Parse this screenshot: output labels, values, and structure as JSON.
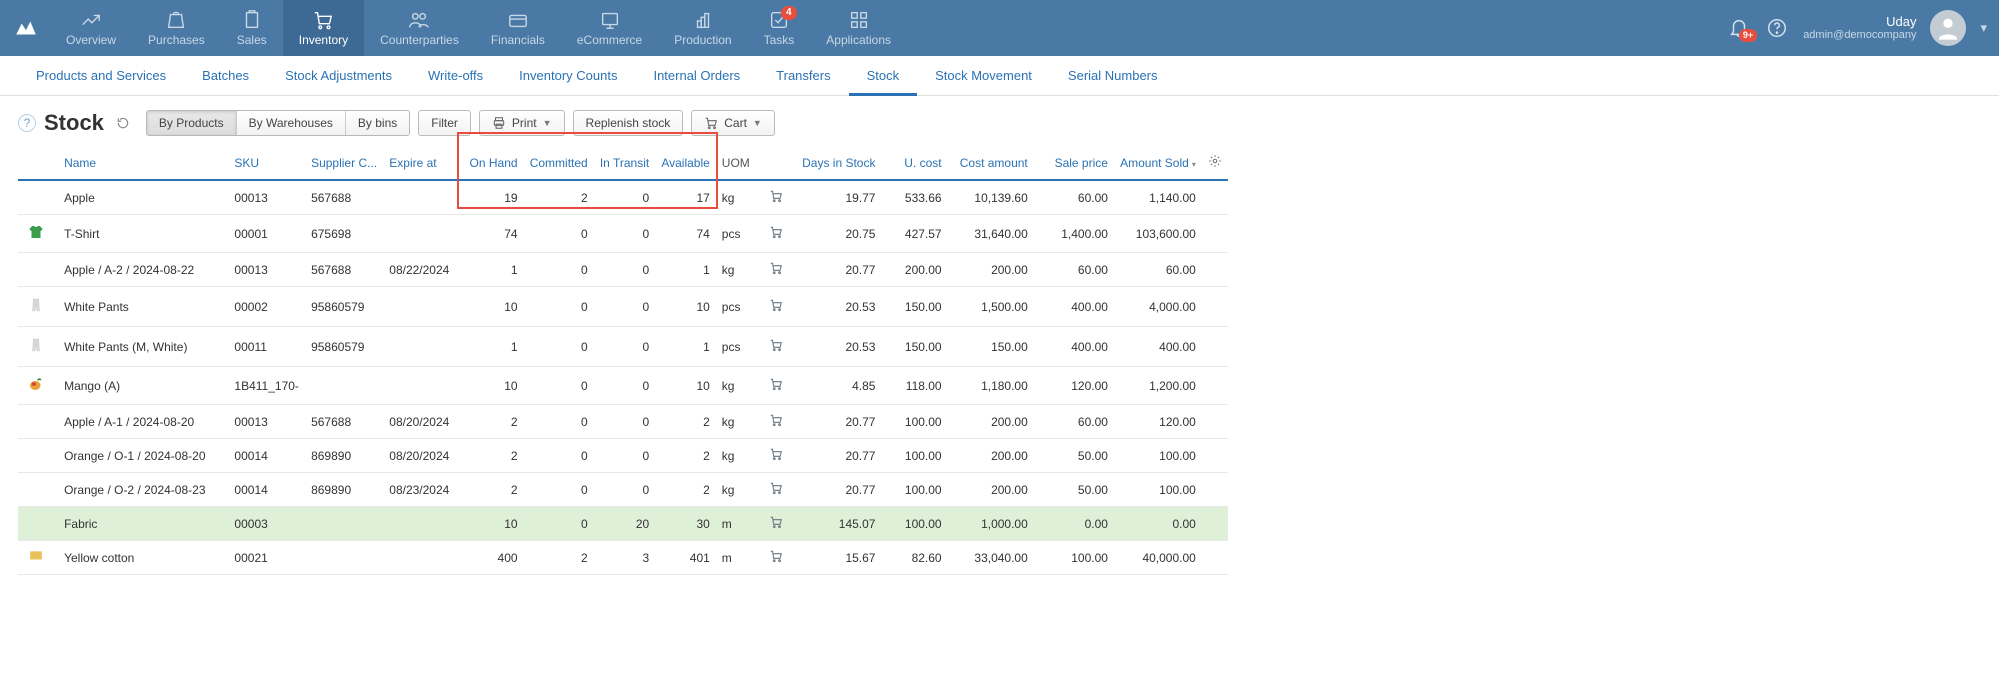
{
  "topnav": {
    "items": [
      {
        "label": "Overview"
      },
      {
        "label": "Purchases"
      },
      {
        "label": "Sales"
      },
      {
        "label": "Inventory"
      },
      {
        "label": "Counterparties"
      },
      {
        "label": "Financials"
      },
      {
        "label": "eCommerce"
      },
      {
        "label": "Production"
      },
      {
        "label": "Tasks"
      },
      {
        "label": "Applications"
      }
    ],
    "tasks_badge": "4",
    "bell_badge": "9+",
    "user": {
      "name": "Uday",
      "email": "admin@democompany"
    }
  },
  "subnav": {
    "tabs": [
      {
        "label": "Products and Services"
      },
      {
        "label": "Batches"
      },
      {
        "label": "Stock Adjustments"
      },
      {
        "label": "Write-offs"
      },
      {
        "label": "Inventory Counts"
      },
      {
        "label": "Internal Orders"
      },
      {
        "label": "Transfers"
      },
      {
        "label": "Stock"
      },
      {
        "label": "Stock Movement"
      },
      {
        "label": "Serial Numbers"
      }
    ],
    "active_index": 7
  },
  "toolbar": {
    "title": "Stock",
    "segments": [
      {
        "label": "By Products"
      },
      {
        "label": "By Warehouses"
      },
      {
        "label": "By bins"
      }
    ],
    "segment_active": 0,
    "filter": "Filter",
    "print": "Print",
    "replenish": "Replenish stock",
    "cart": "Cart"
  },
  "table": {
    "columns": {
      "name": "Name",
      "sku": "SKU",
      "supplier_code": "Supplier C...",
      "expire": "Expire at",
      "on_hand": "On Hand",
      "committed": "Committed",
      "in_transit": "In Transit",
      "available": "Available",
      "uom": "UOM",
      "days_in_stock": "Days in Stock",
      "u_cost": "U. cost",
      "cost_amount": "Cost amount",
      "sale_price": "Sale price",
      "amount_sold": "Amount Sold"
    },
    "rows": [
      {
        "icon": "",
        "name": "Apple",
        "sku": "00013",
        "supplier_code": "567688",
        "expire": "",
        "on_hand": "19",
        "committed": "2",
        "in_transit": "0",
        "available": "17",
        "uom": "kg",
        "days": "19.77",
        "u_cost": "533.66",
        "cost_amount": "10,139.60",
        "sale_price": "60.00",
        "amount_sold": "1,140.00"
      },
      {
        "icon": "tshirt",
        "name": "T-Shirt",
        "sku": "00001",
        "supplier_code": "675698",
        "expire": "",
        "on_hand": "74",
        "committed": "0",
        "in_transit": "0",
        "available": "74",
        "uom": "pcs",
        "days": "20.75",
        "u_cost": "427.57",
        "cost_amount": "31,640.00",
        "sale_price": "1,400.00",
        "amount_sold": "103,600.00"
      },
      {
        "icon": "",
        "name": "Apple / A-2 / 2024-08-22",
        "sku": "00013",
        "supplier_code": "567688",
        "expire": "08/22/2024",
        "on_hand": "1",
        "committed": "0",
        "in_transit": "0",
        "available": "1",
        "uom": "kg",
        "days": "20.77",
        "u_cost": "200.00",
        "cost_amount": "200.00",
        "sale_price": "60.00",
        "amount_sold": "60.00"
      },
      {
        "icon": "pants",
        "name": "White Pants",
        "sku": "00002",
        "supplier_code": "95860579",
        "expire": "",
        "on_hand": "10",
        "committed": "0",
        "in_transit": "0",
        "available": "10",
        "uom": "pcs",
        "days": "20.53",
        "u_cost": "150.00",
        "cost_amount": "1,500.00",
        "sale_price": "400.00",
        "amount_sold": "4,000.00"
      },
      {
        "icon": "pants",
        "name": "White Pants (M, White)",
        "sku": "00011",
        "supplier_code": "95860579",
        "expire": "",
        "on_hand": "1",
        "committed": "0",
        "in_transit": "0",
        "available": "1",
        "uom": "pcs",
        "days": "20.53",
        "u_cost": "150.00",
        "cost_amount": "150.00",
        "sale_price": "400.00",
        "amount_sold": "400.00"
      },
      {
        "icon": "mango",
        "name": "Mango (A)",
        "sku": "1B411_170-",
        "supplier_code": "",
        "expire": "",
        "on_hand": "10",
        "committed": "0",
        "in_transit": "0",
        "available": "10",
        "uom": "kg",
        "days": "4.85",
        "u_cost": "118.00",
        "cost_amount": "1,180.00",
        "sale_price": "120.00",
        "amount_sold": "1,200.00"
      },
      {
        "icon": "",
        "name": "Apple / A-1 / 2024-08-20",
        "sku": "00013",
        "supplier_code": "567688",
        "expire": "08/20/2024",
        "on_hand": "2",
        "committed": "0",
        "in_transit": "0",
        "available": "2",
        "uom": "kg",
        "days": "20.77",
        "u_cost": "100.00",
        "cost_amount": "200.00",
        "sale_price": "60.00",
        "amount_sold": "120.00"
      },
      {
        "icon": "",
        "name": "Orange / O-1 / 2024-08-20",
        "sku": "00014",
        "supplier_code": "869890",
        "expire": "08/20/2024",
        "on_hand": "2",
        "committed": "0",
        "in_transit": "0",
        "available": "2",
        "uom": "kg",
        "days": "20.77",
        "u_cost": "100.00",
        "cost_amount": "200.00",
        "sale_price": "50.00",
        "amount_sold": "100.00"
      },
      {
        "icon": "",
        "name": "Orange / O-2 / 2024-08-23",
        "sku": "00014",
        "supplier_code": "869890",
        "expire": "08/23/2024",
        "on_hand": "2",
        "committed": "0",
        "in_transit": "0",
        "available": "2",
        "uom": "kg",
        "days": "20.77",
        "u_cost": "100.00",
        "cost_amount": "200.00",
        "sale_price": "50.00",
        "amount_sold": "100.00"
      },
      {
        "icon": "",
        "name": "Fabric",
        "sku": "00003",
        "supplier_code": "",
        "expire": "",
        "on_hand": "10",
        "committed": "0",
        "in_transit": "20",
        "available": "30",
        "uom": "m",
        "days": "145.07",
        "u_cost": "100.00",
        "cost_amount": "1,000.00",
        "sale_price": "0.00",
        "amount_sold": "0.00",
        "selected": true
      },
      {
        "icon": "swatch",
        "name": "Yellow cotton",
        "sku": "00021",
        "supplier_code": "",
        "expire": "",
        "on_hand": "400",
        "committed": "2",
        "in_transit": "3",
        "available": "401",
        "uom": "m",
        "days": "15.67",
        "u_cost": "82.60",
        "cost_amount": "33,040.00",
        "sale_price": "100.00",
        "amount_sold": "40,000.00"
      }
    ]
  }
}
